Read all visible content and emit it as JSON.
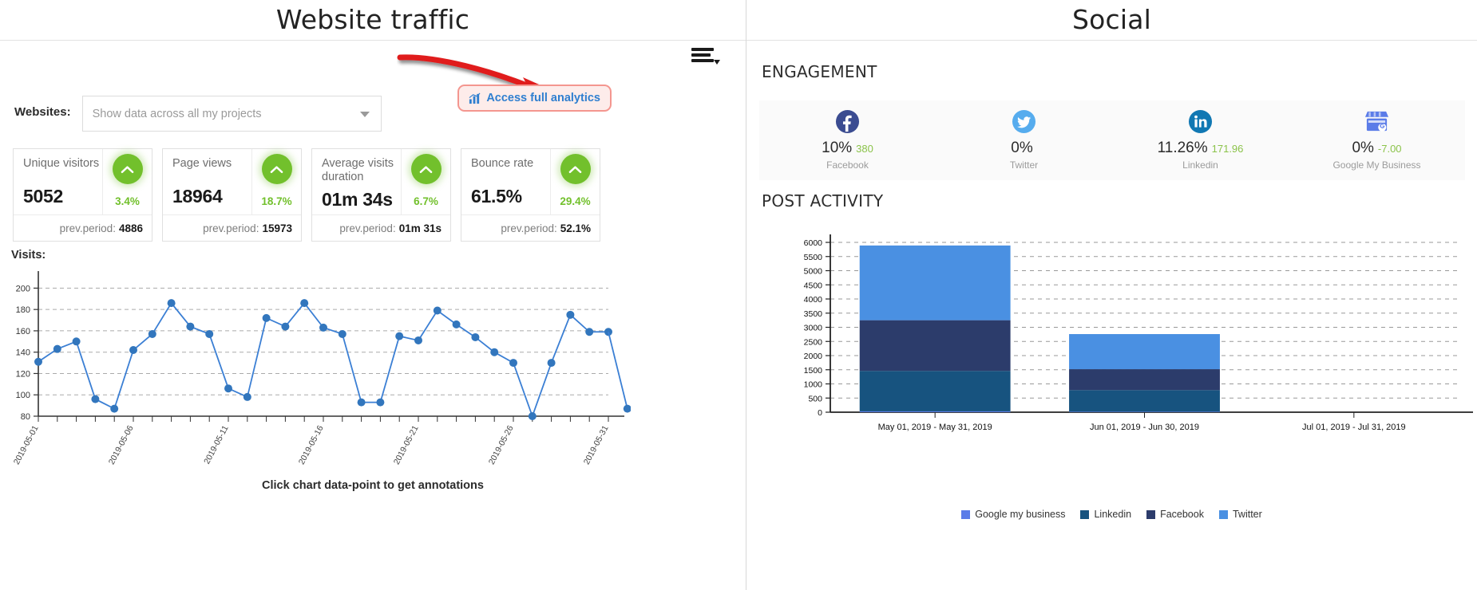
{
  "left": {
    "title": "Website traffic",
    "menu_icon": "hamburger-menu-icon",
    "websites_label": "Websites:",
    "websites_select_value": "Show data across all my projects",
    "analytics_link": "Access full analytics",
    "visits_label": "Visits:",
    "chart_hint": "Click chart data-point to get annotations",
    "cards": [
      {
        "title": "Unique visitors",
        "value": "5052",
        "pct": "3.4%",
        "direction": "up",
        "prev_label": "prev.period:",
        "prev_value": "4886"
      },
      {
        "title": "Page views",
        "value": "18964",
        "pct": "18.7%",
        "direction": "up",
        "prev_label": "prev.period:",
        "prev_value": "15973"
      },
      {
        "title": "Average visits duration",
        "value": "01m 34s",
        "pct": "6.7%",
        "direction": "up",
        "prev_label": "prev.period:",
        "prev_value": "01m 31s"
      },
      {
        "title": "Bounce rate",
        "value": "61.5%",
        "pct": "29.4%",
        "direction": "up",
        "prev_label": "prev.period:",
        "prev_value": "52.1%"
      }
    ]
  },
  "right": {
    "title": "Social",
    "engagement_label": "ENGAGEMENT",
    "post_activity_label": "POST ACTIVITY",
    "engagement": [
      {
        "icon": "facebook-icon",
        "value": "10%",
        "delta": "380",
        "name": "Facebook"
      },
      {
        "icon": "twitter-icon",
        "value": "0%",
        "delta": "",
        "name": "Twitter"
      },
      {
        "icon": "linkedin-icon",
        "value": "11.26%",
        "delta": "171.96",
        "name": "Linkedin"
      },
      {
        "icon": "google-my-business-icon",
        "value": "0%",
        "delta": "-7.00",
        "name": "Google My Business"
      }
    ]
  },
  "colors": {
    "accent_blue": "#3b7fd4",
    "link_blue": "#2f7fd0",
    "green": "#72c02c",
    "google_my_business": "#5b7ce8",
    "linkedin": "#17537f",
    "facebook": "#2c3c6b",
    "twitter": "#4a90e2",
    "highlight_border": "#f4968f",
    "highlight_fill": "#fdecea",
    "arrow_red": "#e01b1b"
  },
  "chart_data": [
    {
      "type": "line",
      "title": "Visits:",
      "xlabel": "",
      "ylabel": "",
      "ylim": [
        80,
        210
      ],
      "yticks": [
        80,
        100,
        120,
        140,
        160,
        180,
        200
      ],
      "grid": true,
      "tick_labels": [
        "2019-05-01",
        "2019-05-06",
        "2019-05-11",
        "2019-05-16",
        "2019-05-21",
        "2019-05-26",
        "2019-05-31"
      ],
      "tick_label_indices": [
        0,
        5,
        10,
        15,
        20,
        25,
        30
      ],
      "x": [
        "2019-05-01",
        "2019-05-02",
        "2019-05-03",
        "2019-05-04",
        "2019-05-05",
        "2019-05-06",
        "2019-05-07",
        "2019-05-08",
        "2019-05-09",
        "2019-05-10",
        "2019-05-11",
        "2019-05-12",
        "2019-05-13",
        "2019-05-14",
        "2019-05-15",
        "2019-05-16",
        "2019-05-17",
        "2019-05-18",
        "2019-05-19",
        "2019-05-20",
        "2019-05-21",
        "2019-05-22",
        "2019-05-23",
        "2019-05-24",
        "2019-05-25",
        "2019-05-26",
        "2019-05-27",
        "2019-05-28",
        "2019-05-29",
        "2019-05-30",
        "2019-05-31"
      ],
      "values": [
        131,
        143,
        150,
        96,
        87,
        142,
        157,
        186,
        164,
        157,
        106,
        98,
        172,
        164,
        186,
        163,
        157,
        93,
        93,
        155,
        151,
        179,
        166,
        154,
        140,
        130,
        80,
        130,
        175,
        159,
        159
      ],
      "last_value": 87,
      "hint": "Click chart data-point to get annotations"
    },
    {
      "type": "bar",
      "subtype": "stacked",
      "title": "POST ACTIVITY",
      "categories": [
        "May 01, 2019 - May 31, 2019",
        "Jun 01, 2019 - Jun 30, 2019",
        "Jul 01, 2019 - Jul 31, 2019"
      ],
      "ylim": [
        0,
        6000
      ],
      "yticks": [
        0,
        500,
        1000,
        1500,
        2000,
        2500,
        3000,
        3500,
        4000,
        4500,
        5000,
        5500,
        6000
      ],
      "grid": true,
      "legend_position": "bottom",
      "series": [
        {
          "name": "Google my business",
          "color": "#5b7ce8",
          "values": [
            30,
            20,
            0
          ]
        },
        {
          "name": "Linkedin",
          "color": "#17537f",
          "values": [
            1430,
            760,
            0
          ]
        },
        {
          "name": "Facebook",
          "color": "#2c3c6b",
          "values": [
            1790,
            740,
            0
          ]
        },
        {
          "name": "Twitter",
          "color": "#4a90e2",
          "values": [
            2640,
            1240,
            0
          ]
        }
      ]
    }
  ]
}
